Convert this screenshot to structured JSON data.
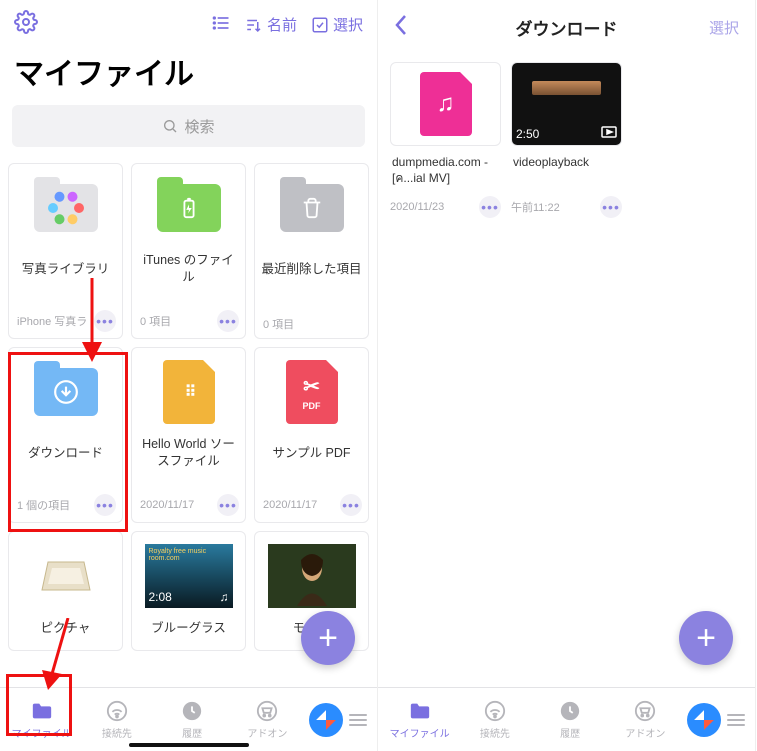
{
  "left": {
    "title": "マイファイル",
    "topbar": {
      "sort_label": "名前",
      "select_label": "選択"
    },
    "search_placeholder": "検索",
    "items": [
      {
        "label": "写真ライブラリ",
        "meta": "iPhone 写真ラ"
      },
      {
        "label": "iTunes のファイル",
        "meta": "0 項目"
      },
      {
        "label": "最近削除した項目",
        "meta": "0 項目"
      },
      {
        "label": "ダウンロード",
        "meta": "1 個の項目"
      },
      {
        "label": "Hello World ソースファイル",
        "meta": "2020/11/17"
      },
      {
        "label": "サンプル PDF",
        "meta": "2020/11/17"
      },
      {
        "label": "ピクチャ",
        "meta": ""
      },
      {
        "label": "ブルーグラス",
        "meta": "",
        "badge": "2:08"
      },
      {
        "label": "モナリ",
        "meta": ""
      }
    ],
    "tabs": [
      "マイファイル",
      "接続先",
      "履歴",
      "アドオン"
    ]
  },
  "right": {
    "title": "ダウンロード",
    "select_label": "選択",
    "items": [
      {
        "label": "dumpmedia.com - [ค...ial MV]",
        "meta": "2020/11/23"
      },
      {
        "label": "videoplayback",
        "meta": "午前11:22",
        "badge": "2:50"
      }
    ],
    "tabs": [
      "マイファイル",
      "接続先",
      "履歴",
      "アドオン"
    ]
  }
}
